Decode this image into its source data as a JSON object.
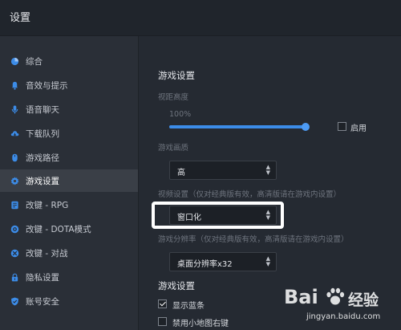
{
  "window": {
    "title": "设置"
  },
  "sidebar": {
    "items": [
      {
        "label": "综合",
        "icon": "pie-chart-icon",
        "active": false
      },
      {
        "label": "音效与提示",
        "icon": "bell-icon",
        "active": false
      },
      {
        "label": "语音聊天",
        "icon": "microphone-icon",
        "active": false
      },
      {
        "label": "下载队列",
        "icon": "cloud-download-icon",
        "active": false
      },
      {
        "label": "游戏路径",
        "icon": "mouse-icon",
        "active": false
      },
      {
        "label": "游戏设置",
        "icon": "gear-icon",
        "active": true
      },
      {
        "label": "改键 - RPG",
        "icon": "keyboard-icon",
        "active": false
      },
      {
        "label": "改键 - DOTA模式",
        "icon": "dota-icon",
        "active": false
      },
      {
        "label": "改键 - 对战",
        "icon": "versus-icon",
        "active": false
      },
      {
        "label": "隐私设置",
        "icon": "lock-icon",
        "active": false
      },
      {
        "label": "账号安全",
        "icon": "shield-icon",
        "active": false
      }
    ]
  },
  "main": {
    "section_title": "游戏设置",
    "view_height": {
      "label": "视距高度",
      "value_text": "100%",
      "level": 1.0
    },
    "enable_checkbox": {
      "label": "启用",
      "checked": false
    },
    "quality": {
      "label": "游戏画质",
      "selected": "高"
    },
    "video": {
      "label": "视频设置（仅对经典版有效，高清版请在游戏内设置）",
      "selected": "窗口化"
    },
    "resolution": {
      "label": "游戏分辨率（仅对经典版有效，高清版请在游戏内设置）",
      "selected": "桌面分辨率x32"
    },
    "section2_title": "游戏设置",
    "show_blue_bar": {
      "label": "显示蓝条",
      "checked": true
    },
    "disable_minimap_right": {
      "label": "禁用小地图右键",
      "checked": false
    }
  },
  "watermark": {
    "brand": "Bai",
    "brand2": "经验",
    "url": "jingyan.baidu.com"
  },
  "colors": {
    "accent": "#3c8ce8",
    "active_bg": "#3a3f47",
    "sidebar_bg": "#2a2f37",
    "content_bg": "#252a32"
  }
}
